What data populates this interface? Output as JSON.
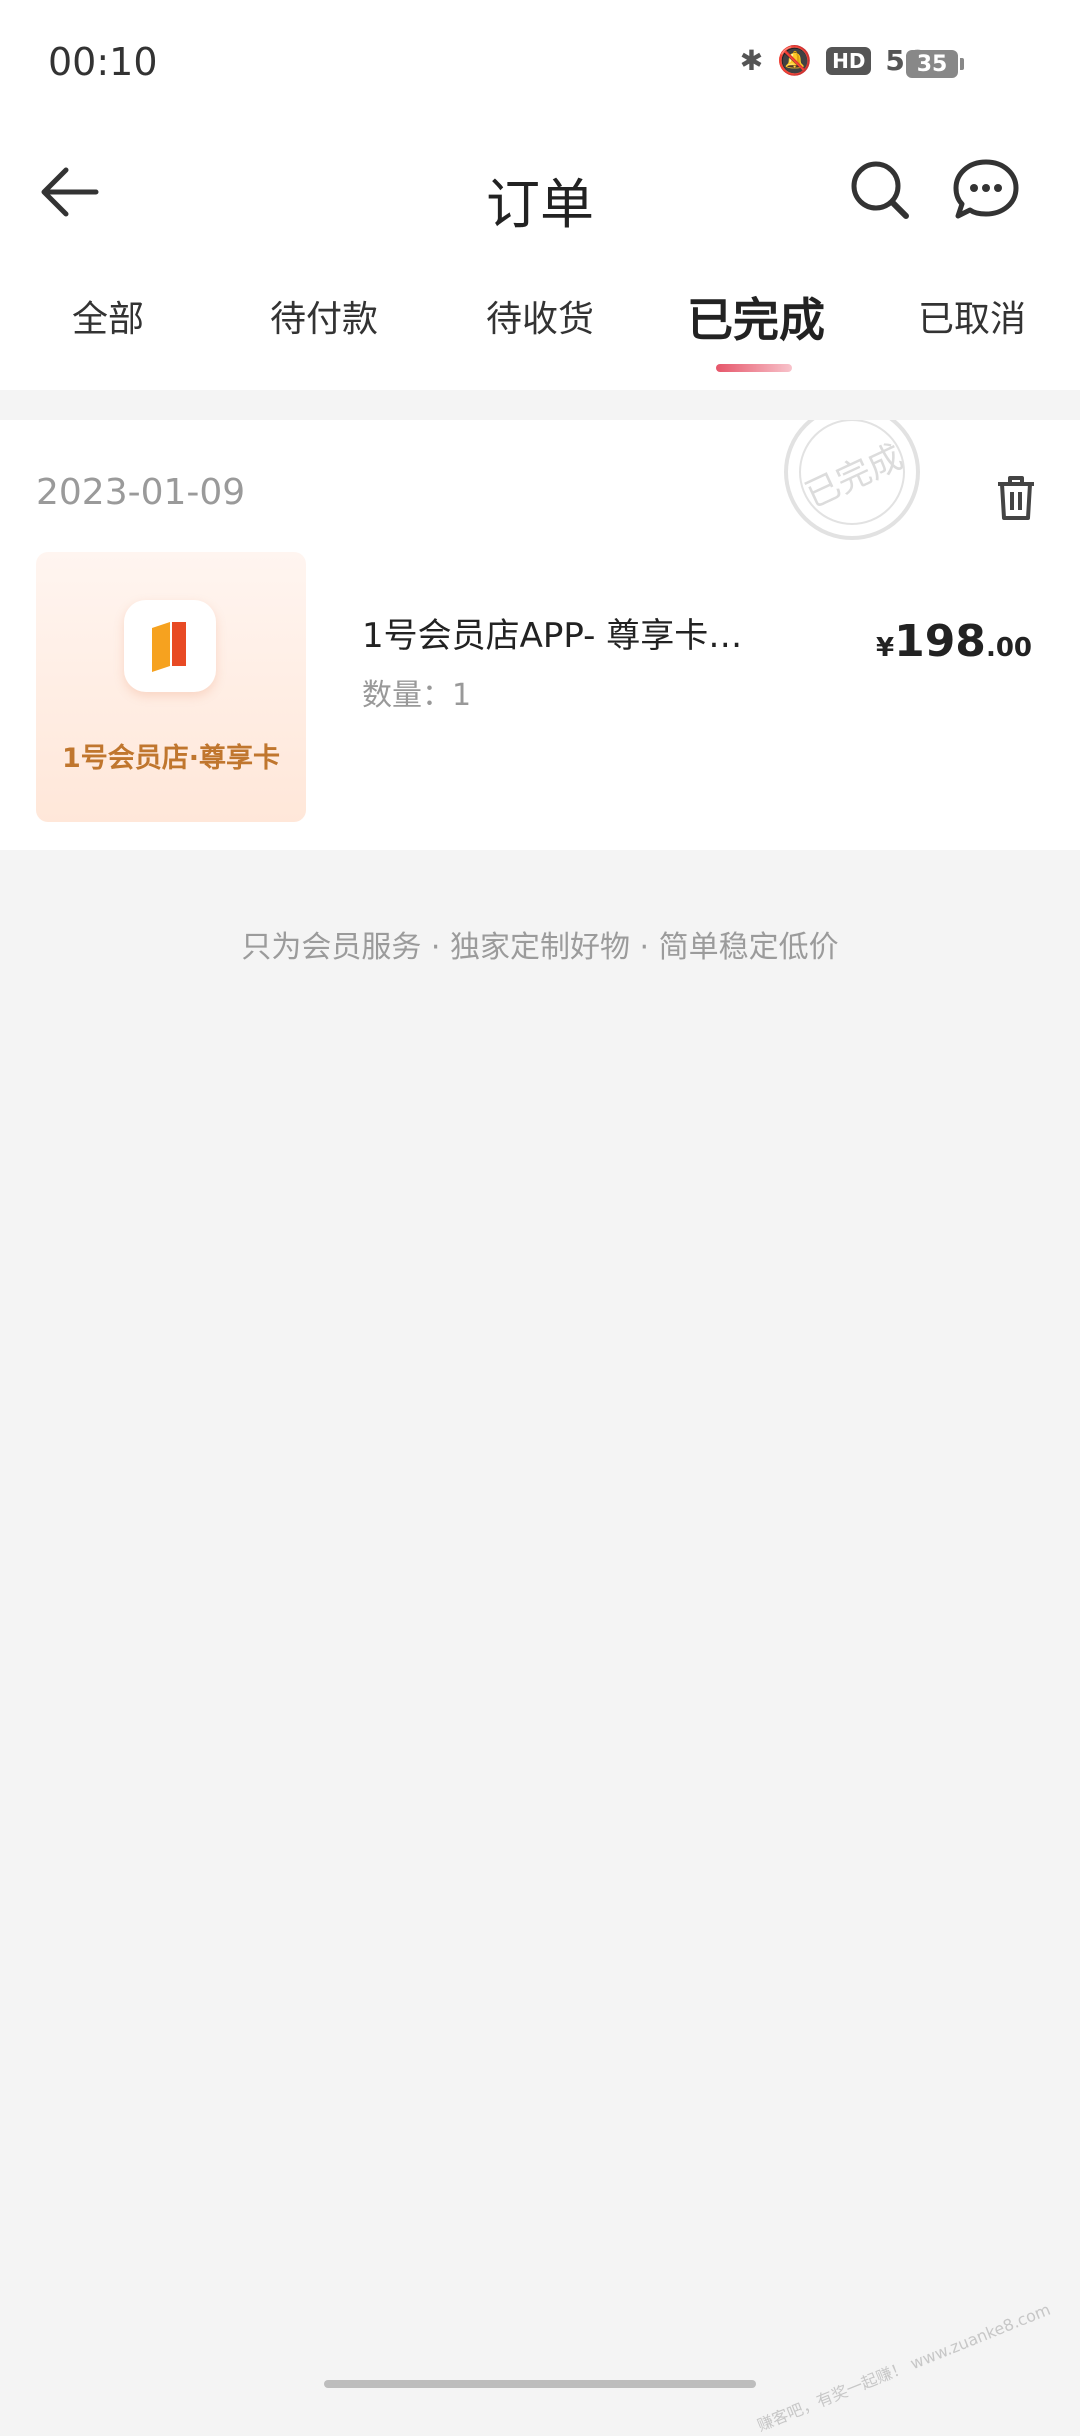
{
  "status_bar": {
    "time": "00:10",
    "network": "5G",
    "hd": "HD",
    "battery": "35"
  },
  "header": {
    "title": "订单"
  },
  "tabs": [
    {
      "label": "全部"
    },
    {
      "label": "待付款"
    },
    {
      "label": "待收货"
    },
    {
      "label": "已完成",
      "active": true
    },
    {
      "label": "已取消"
    }
  ],
  "order": {
    "date": "2023-01-09",
    "stamp_text": "已完成",
    "thumbnail_label": "1号会员店·尊享卡",
    "product_name": "1号会员店APP- 尊享卡…",
    "quantity": "数量：1",
    "price_currency": "¥",
    "price_int": "198",
    "price_dec": ".00"
  },
  "slogan": "只为会员服务 · 独家定制好物 · 简单稳定低价",
  "watermark": "赚客吧，有奖一起赚！ www.zuanke8.com",
  "colors": {
    "accent": "#e6566a",
    "price": "#222222",
    "background": "#f4f4f4"
  }
}
